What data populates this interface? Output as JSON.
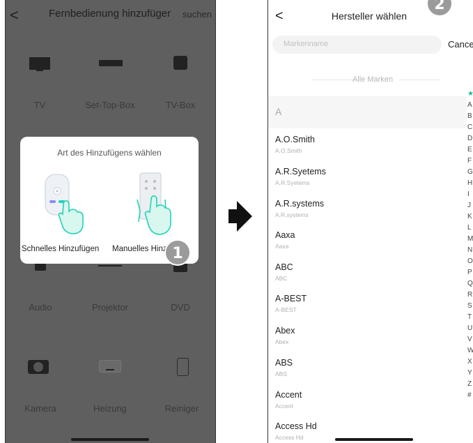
{
  "left_screen": {
    "back_label": "<",
    "title": "Fernbedienung hinzufügen",
    "search_label": "suchen",
    "devices": [
      {
        "label": "TV",
        "icon": "tv-icon"
      },
      {
        "label": "Set-Top-Box",
        "icon": "settopbox-icon"
      },
      {
        "label": "TV-Box",
        "icon": "tvbox-icon"
      },
      {
        "label": "Audio",
        "icon": "audio-icon"
      },
      {
        "label": "Projektor",
        "icon": "projector-icon"
      },
      {
        "label": "DVD",
        "icon": "dvd-icon"
      },
      {
        "label": "Kamera",
        "icon": "camera-icon"
      },
      {
        "label": "Heizung",
        "icon": "heater-icon"
      },
      {
        "label": "Reiniger",
        "icon": "purifier-icon"
      }
    ],
    "dialog": {
      "title": "Art des Hinzufügens wählen",
      "option_quick": "Schnelles Hinzufügen",
      "option_manual": "Manuelles Hinzufügen"
    },
    "step_badge": "1"
  },
  "right_screen": {
    "back_label": "<",
    "title": "Hersteller wählen",
    "step_badge": "2",
    "search_placeholder": "Markenname",
    "cancel_label": "Cancel",
    "all_brands_label": "Alle Marken",
    "section_letter": "A",
    "brands": [
      {
        "name": "A.O.Smith",
        "sub": "A.O.Smith"
      },
      {
        "name": "A.R.Syetems",
        "sub": "A.R.Syetems"
      },
      {
        "name": "A.R.systems",
        "sub": "A.R.systems"
      },
      {
        "name": "Aaxa",
        "sub": "Aaxa"
      },
      {
        "name": "ABC",
        "sub": "ABC"
      },
      {
        "name": "A-BEST",
        "sub": "A-BEST"
      },
      {
        "name": "Abex",
        "sub": "Abex"
      },
      {
        "name": "ABS",
        "sub": "ABS"
      },
      {
        "name": "Accent",
        "sub": "Accent"
      },
      {
        "name": "Access Hd",
        "sub": "Access Hd"
      }
    ],
    "index_letters": [
      "★",
      "A",
      "B",
      "C",
      "D",
      "E",
      "F",
      "G",
      "H",
      "I",
      "J",
      "K",
      "L",
      "M",
      "N",
      "O",
      "P",
      "Q",
      "R",
      "S",
      "T",
      "U",
      "V",
      "W",
      "X",
      "Y",
      "Z",
      "#"
    ]
  },
  "colors": {
    "accent_teal": "#22d3b5",
    "overlay_gray": "#5f5f5f",
    "badge_gray": "#9b9b9b",
    "index_star": "#1db992"
  }
}
